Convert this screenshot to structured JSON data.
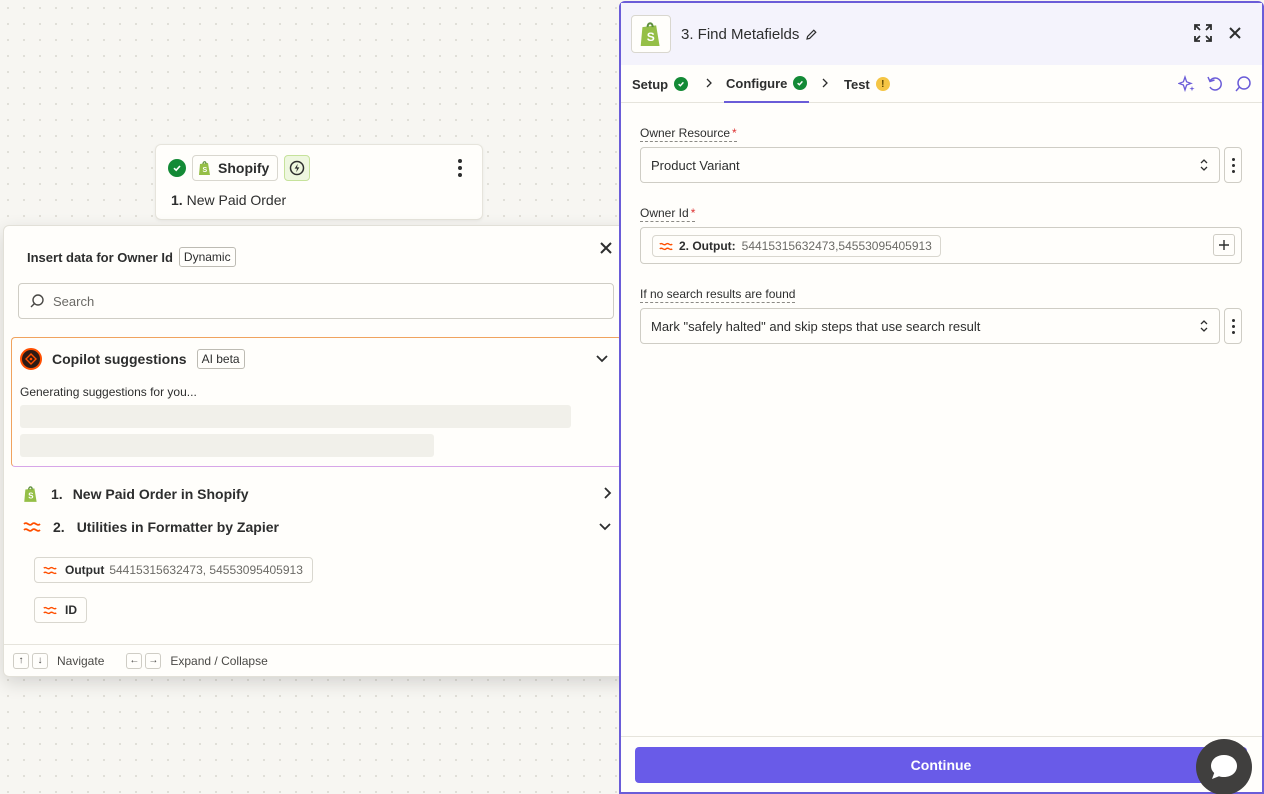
{
  "canvas_step": {
    "app_name": "Shopify",
    "number": "1.",
    "title": "New Paid Order"
  },
  "insert_panel": {
    "title": "Insert data for Owner Id",
    "badge": "Dynamic",
    "search_placeholder": "Search",
    "copilot": {
      "title": "Copilot suggestions",
      "badge": "AI beta",
      "status": "Generating suggestions for you..."
    },
    "steps": [
      {
        "number": "1.",
        "label": "New Paid Order in Shopify"
      },
      {
        "number": "2.",
        "label": "Utilities in Formatter by Zapier"
      }
    ],
    "fields": [
      {
        "name": "Output",
        "value": "54415315632473, 54553095405913"
      },
      {
        "name": "ID",
        "value": ""
      }
    ],
    "footer": {
      "navigate": "Navigate",
      "expand": "Expand / Collapse",
      "up_key": "↑",
      "down_key": "↓",
      "left_key": "←",
      "right_key": "→"
    }
  },
  "editor": {
    "title": "3. Find Metafields",
    "tabs": [
      {
        "label": "Setup",
        "status": "complete"
      },
      {
        "label": "Configure",
        "status": "complete",
        "active": true
      },
      {
        "label": "Test",
        "status": "warning"
      }
    ],
    "warning_glyph": "!",
    "fields": {
      "owner_resource": {
        "label": "Owner Resource",
        "required": "*",
        "value": "Product Variant"
      },
      "owner_id": {
        "label": "Owner Id",
        "required": "*",
        "pill_label": "2. Output:",
        "pill_value": "54415315632473,54553095405913"
      },
      "no_results": {
        "label": "If no search results are found",
        "value": "Mark \"safely halted\" and skip steps that use search result"
      }
    },
    "continue_label": "Continue"
  },
  "colors": {
    "accent": "#695be8",
    "success": "#138a36",
    "warning": "#f5c544",
    "formatter": "#ff4f00"
  }
}
